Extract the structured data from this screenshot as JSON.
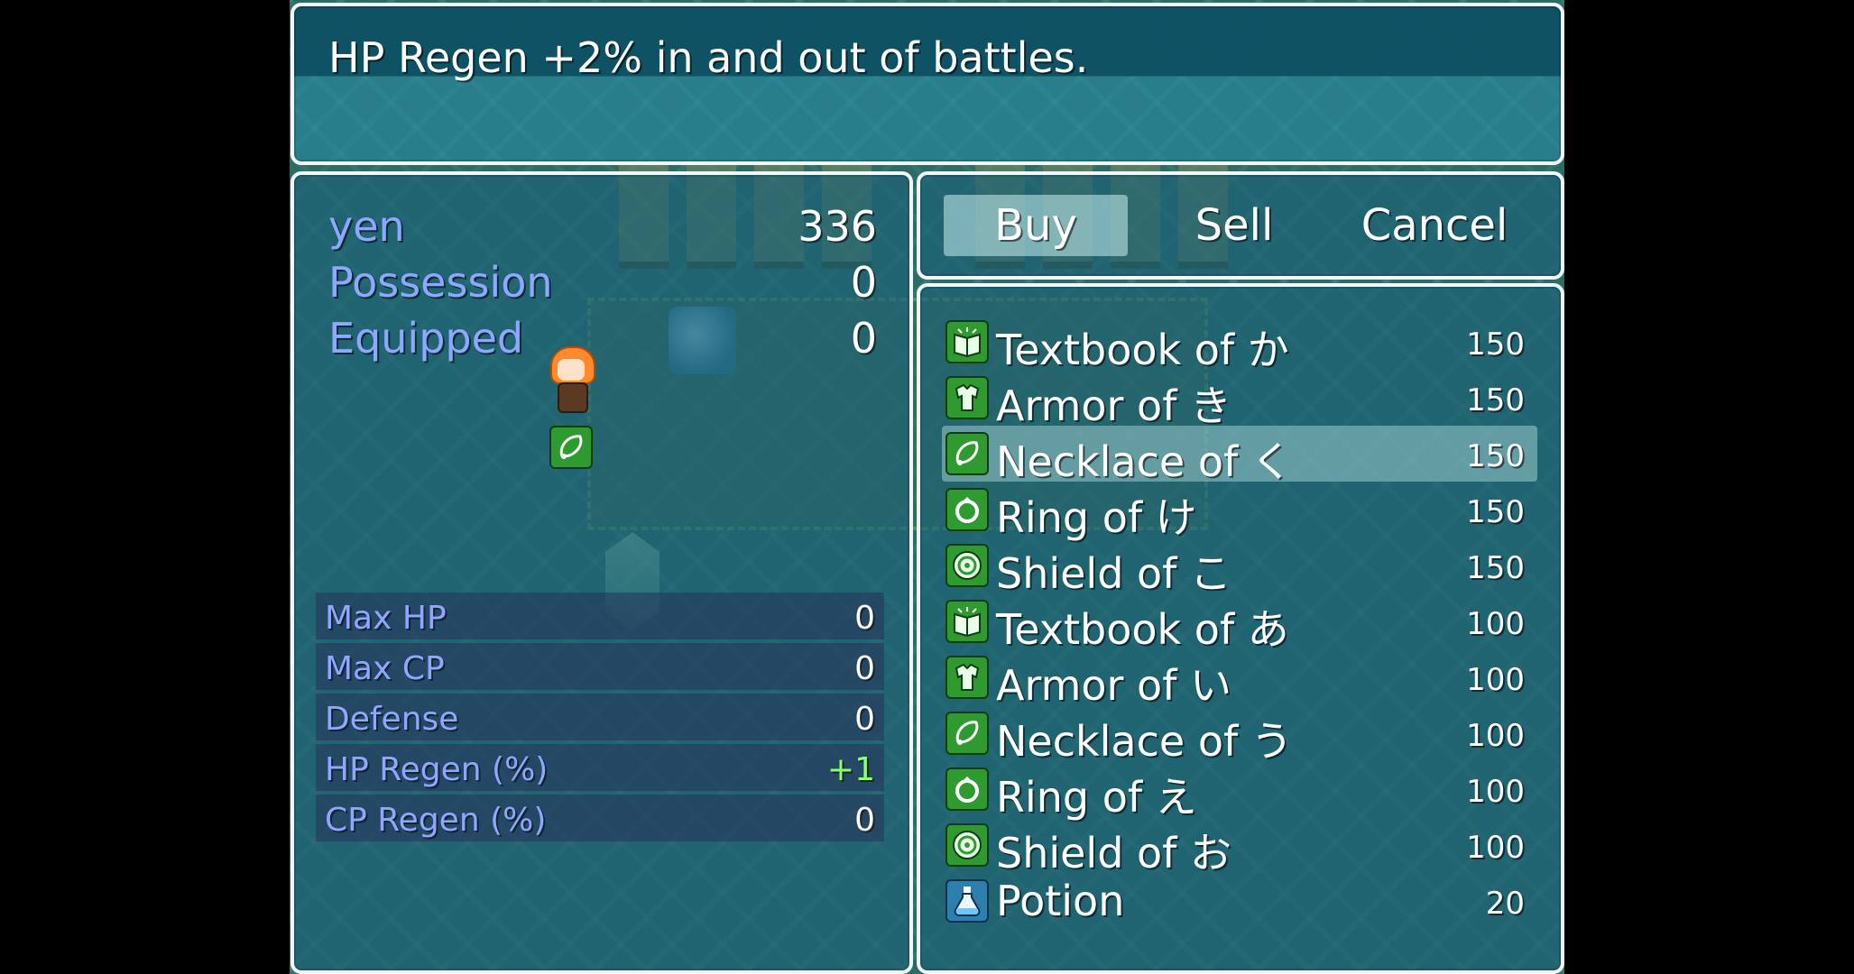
{
  "help": {
    "text": "HP Regen +2% in and out of battles."
  },
  "status": {
    "gold_label": "yen",
    "gold_value": "336",
    "possession_label": "Possession",
    "possession_value": "0",
    "equipped_label": "Equipped",
    "equipped_value": "0",
    "equipped_icon": "necklace-icon",
    "params": [
      {
        "label": "Max HP",
        "value": "0"
      },
      {
        "label": "Max CP",
        "value": "0"
      },
      {
        "label": "Defense",
        "value": "0"
      },
      {
        "label": "HP Regen (%)",
        "value": "+1"
      },
      {
        "label": "CP Regen (%)",
        "value": "0"
      }
    ]
  },
  "commands": {
    "buy": "Buy",
    "sell": "Sell",
    "cancel": "Cancel"
  },
  "items": [
    {
      "name": "Textbook of か",
      "price": "150",
      "icon": "textbook-icon"
    },
    {
      "name": "Armor of き",
      "price": "150",
      "icon": "armor-icon"
    },
    {
      "name": "Necklace of く",
      "price": "150",
      "icon": "necklace-icon"
    },
    {
      "name": "Ring of け",
      "price": "150",
      "icon": "ring-icon"
    },
    {
      "name": "Shield of こ",
      "price": "150",
      "icon": "shield-icon"
    },
    {
      "name": "Textbook of あ",
      "price": "100",
      "icon": "textbook-icon"
    },
    {
      "name": "Armor of い",
      "price": "100",
      "icon": "armor-icon"
    },
    {
      "name": "Necklace of う",
      "price": "100",
      "icon": "necklace-icon"
    },
    {
      "name": "Ring of え",
      "price": "100",
      "icon": "ring-icon"
    },
    {
      "name": "Shield of お",
      "price": "100",
      "icon": "shield-icon"
    },
    {
      "name": "Potion",
      "price": "20",
      "icon": "potion-icon"
    }
  ],
  "colors": {
    "system_text": "#8fa7ff",
    "normal_text": "#ffffff",
    "power_up": "#8cff6a",
    "window_border": "#f2f6f7"
  }
}
